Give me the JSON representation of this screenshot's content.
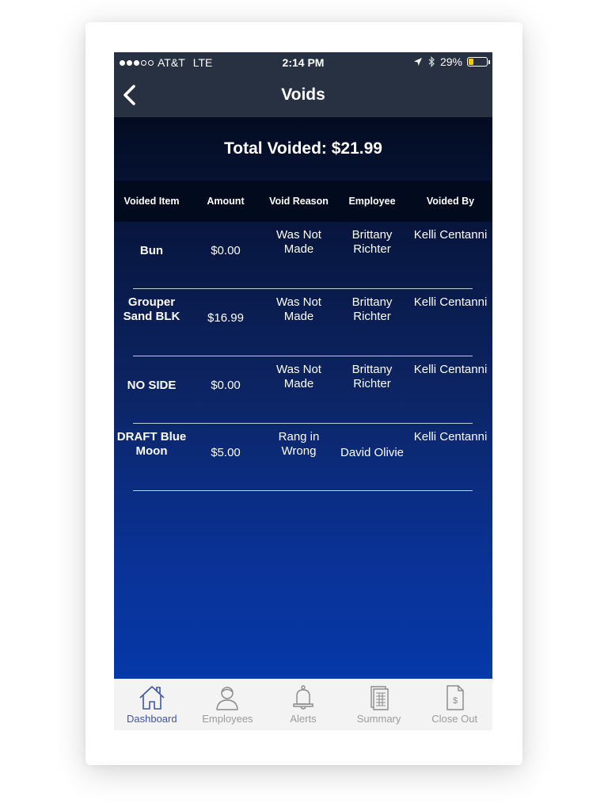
{
  "status_bar": {
    "carrier": "AT&T",
    "network": "LTE",
    "time": "2:14 PM",
    "battery_percent": "29%",
    "battery_level": 0.29,
    "icons": [
      "location-arrow-icon",
      "bluetooth-icon",
      "battery-icon"
    ]
  },
  "nav": {
    "title": "Voids",
    "back_icon": "chevron-left-icon"
  },
  "total_voided": "Total Voided: $21.99",
  "table": {
    "columns": [
      "Voided Item",
      "Amount",
      "Void Reason",
      "Employee",
      "Voided By"
    ],
    "rows": [
      {
        "item": "Bun",
        "amount": "$0.00",
        "reason": "Was Not Made",
        "employee": "Brittany Richter",
        "voided_by": "Kelli Centanni"
      },
      {
        "item": "Grouper Sand BLK",
        "amount": "$16.99",
        "reason": "Was Not Made",
        "employee": "Brittany Richter",
        "voided_by": "Kelli Centanni"
      },
      {
        "item": "NO SIDE",
        "amount": "$0.00",
        "reason": "Was Not Made",
        "employee": "Brittany Richter",
        "voided_by": "Kelli Centanni"
      },
      {
        "item": "DRAFT Blue Moon",
        "amount": "$5.00",
        "reason": "Rang in Wrong",
        "employee": "David Olivie",
        "voided_by": "Kelli Centanni"
      }
    ]
  },
  "tabs": [
    {
      "label": "Dashboard",
      "icon": "house-icon",
      "active": true
    },
    {
      "label": "Employees",
      "icon": "person-icon",
      "active": false
    },
    {
      "label": "Alerts",
      "icon": "bell-icon",
      "active": false
    },
    {
      "label": "Summary",
      "icon": "report-icon",
      "active": false
    },
    {
      "label": "Close Out",
      "icon": "dollar-document-icon",
      "active": false
    }
  ],
  "colors": {
    "header_bg": "#273142",
    "accent_active_tab": "#3d55a8",
    "tab_inactive": "#9b9b9b",
    "battery_fill": "#f5c518"
  }
}
